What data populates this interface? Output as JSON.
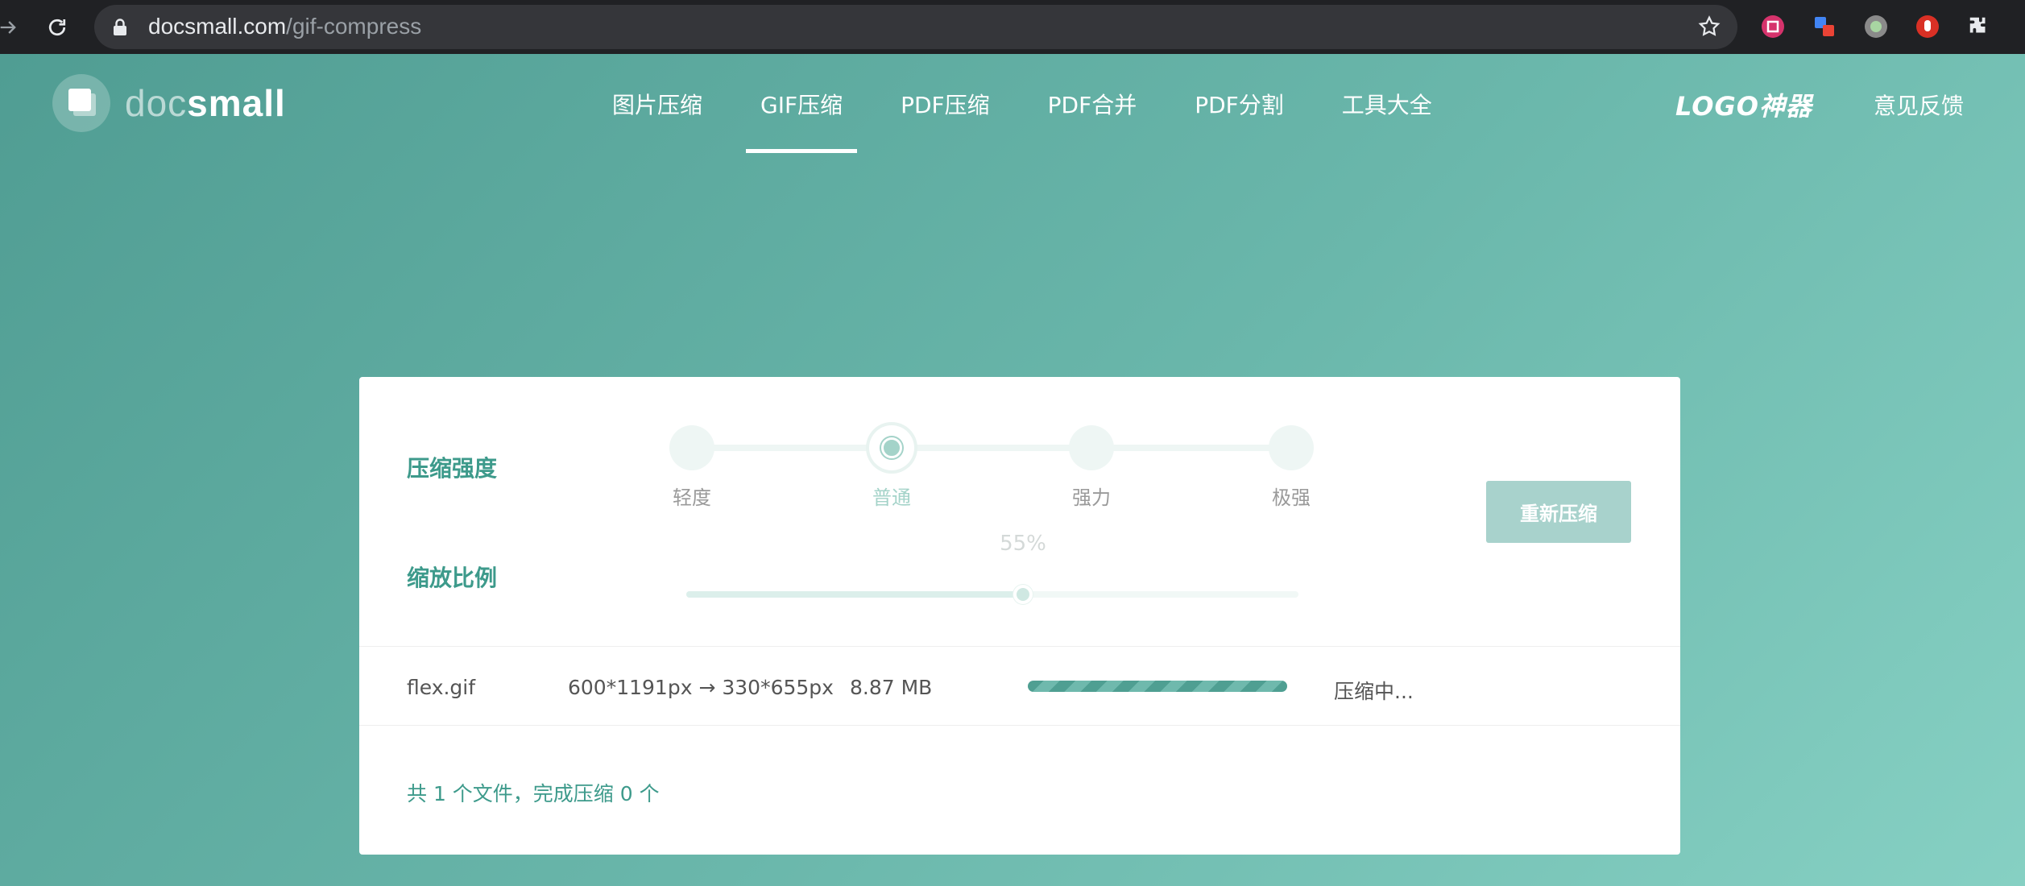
{
  "browser": {
    "url_domain": "docsmall.com",
    "url_path": "/gif-compress"
  },
  "header": {
    "logo_doc": "doc",
    "logo_small": "small",
    "nav": [
      {
        "label": "图片压缩",
        "active": false
      },
      {
        "label": "GIF压缩",
        "active": true
      },
      {
        "label": "PDF压缩",
        "active": false
      },
      {
        "label": "PDF合并",
        "active": false
      },
      {
        "label": "PDF分割",
        "active": false
      },
      {
        "label": "工具大全",
        "active": false
      }
    ],
    "logo_god": "LOGO神器",
    "feedback": "意见反馈"
  },
  "settings": {
    "strength_label": "压缩强度",
    "strength_levels": [
      "轻度",
      "普通",
      "强力",
      "极强"
    ],
    "strength_selected": "普通",
    "scale_label": "缩放比例",
    "scale_value": "55%",
    "scale_fraction": 0.55,
    "recompress_label": "重新压缩"
  },
  "files": [
    {
      "name": "flex.gif",
      "dimensions": "600*1191px → 330*655px",
      "size": "8.87 MB",
      "status": "压缩中..."
    }
  ],
  "summary": "共 1 个文件，完成压缩 0 个",
  "colors": {
    "accent": "#3d9a8b",
    "button": "#a8d2cc",
    "background_start": "#4f9c92",
    "background_end": "#86d0c3"
  }
}
